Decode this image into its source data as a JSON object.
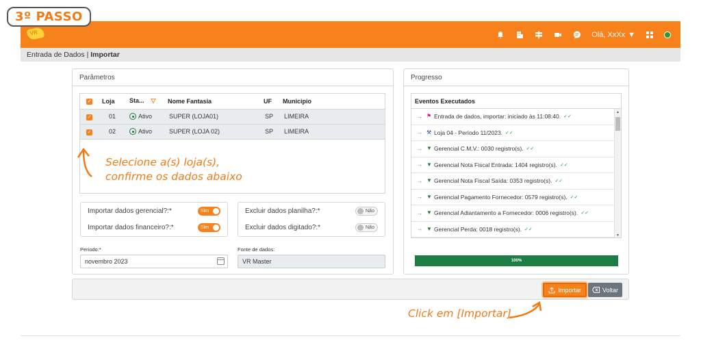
{
  "step_badge": "3º PASSO",
  "header": {
    "user_greeting": "Olá, XxXx",
    "colors": {
      "brand": "#f7811b",
      "online": "#1f9b3a"
    },
    "icons": [
      "bell-icon",
      "building-icon",
      "signpost-icon",
      "video-icon",
      "chat-icon"
    ]
  },
  "breadcrumb": {
    "section": "Entrada de Dados",
    "separator": "|",
    "page": "Importar"
  },
  "parametros": {
    "title": "Parâmetros",
    "columns": {
      "loja": "Loja",
      "status": "Sta...",
      "nome": "Nome Fantasia",
      "uf": "UF",
      "municipio": "Municipio"
    },
    "rows": [
      {
        "loja": "01",
        "status": "Ativo",
        "nome": "SUPER (LOJA01)",
        "uf": "SP",
        "municipio": "LIMEIRA"
      },
      {
        "loja": "02",
        "status": "Ativo",
        "nome": "SUPER (LOJA 02)",
        "uf": "SP",
        "municipio": "LIMEIRA"
      }
    ],
    "options": {
      "gerencial": {
        "label": "Importar dados gerencial?:*",
        "value": "Sim"
      },
      "financeiro": {
        "label": "Importar dados financeiro?:*",
        "value": "Sim"
      },
      "planilha": {
        "label": "Excluir dados planilha?:*",
        "value": "Não"
      },
      "digitado": {
        "label": "Excluir dados digitado?:*",
        "value": "Não"
      }
    },
    "periodo": {
      "label": "Periodo:*",
      "value": "novembro 2023"
    },
    "fonte": {
      "label": "Fonte de dados:",
      "value": "VR Master"
    }
  },
  "progresso": {
    "title": "Progresso",
    "events_title": "Eventos Executados",
    "events": [
      {
        "icon": "flag-icon",
        "color": "#e0197d",
        "text": "Entrada de dados, importar: iniciado às 11:08:40."
      },
      {
        "icon": "hammer-icon",
        "color": "#1f4e8c",
        "text": "Loja 04 - Período 11/2023."
      },
      {
        "icon": "funnel-icon",
        "color": "#1f7a3a",
        "text": "Gerencial C.M.V.: 0030 registro(s)."
      },
      {
        "icon": "funnel-icon",
        "color": "#1f7a3a",
        "text": "Gerencial Nota Fiscal Entrada: 1404 registro(s)."
      },
      {
        "icon": "funnel-icon",
        "color": "#1f7a3a",
        "text": "Gerencial Nota Fiscal Saída: 0353 registro(s)."
      },
      {
        "icon": "funnel-icon",
        "color": "#1f7a3a",
        "text": "Gerencial Pagamento Fornecedor: 0579 registro(s)."
      },
      {
        "icon": "funnel-icon",
        "color": "#1f7a3a",
        "text": "Gerencial Adiantamento a Fornecedor: 0006 registro(s)."
      },
      {
        "icon": "funnel-icon",
        "color": "#1f7a3a",
        "text": "Gerencial Perda: 0018 registro(s)."
      }
    ],
    "progress_value": 100,
    "progress_label": "100%"
  },
  "actions": {
    "import_label": "Importar",
    "back_label": "Voltar"
  },
  "annotations": {
    "select_line1": "Selecione a(s) loja(s),",
    "select_line2": "confirme os dados abaixo",
    "click": "Click em [Importar]"
  }
}
